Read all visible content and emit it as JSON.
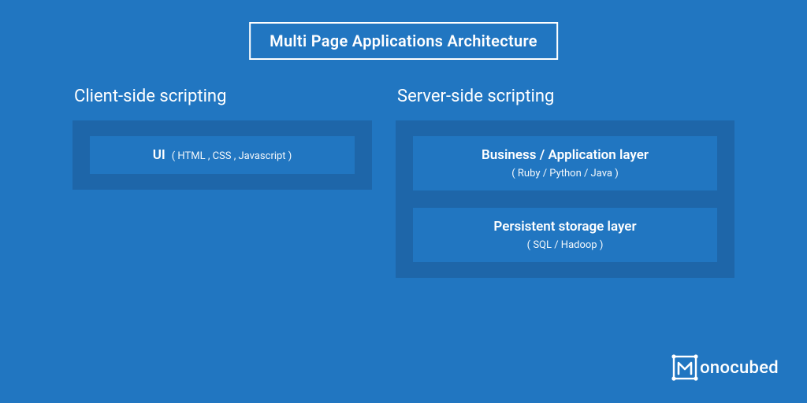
{
  "title": "Multi Page Applications Architecture",
  "client": {
    "heading": "Client-side scripting",
    "layer1": {
      "title": "UI",
      "sub": "( HTML , CSS , Javascript )"
    }
  },
  "server": {
    "heading": "Server-side scripting",
    "layer1": {
      "title": "Business / Application layer",
      "sub": "( Ruby / Python / Java )"
    },
    "layer2": {
      "title": "Persistent storage layer",
      "sub": "( SQL / Hadoop )"
    }
  },
  "logo": {
    "text": "onocubed"
  }
}
